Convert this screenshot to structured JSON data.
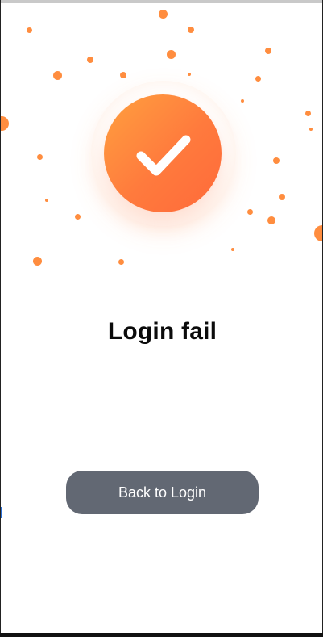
{
  "status": {
    "title": "Login fail"
  },
  "actions": {
    "back_label": "Back to Login"
  },
  "icons": {
    "status_icon": "checkmark-icon"
  },
  "colors": {
    "accent": "#ff7a3d",
    "button_bg": "#626873",
    "dot": "#ff8d3f"
  }
}
